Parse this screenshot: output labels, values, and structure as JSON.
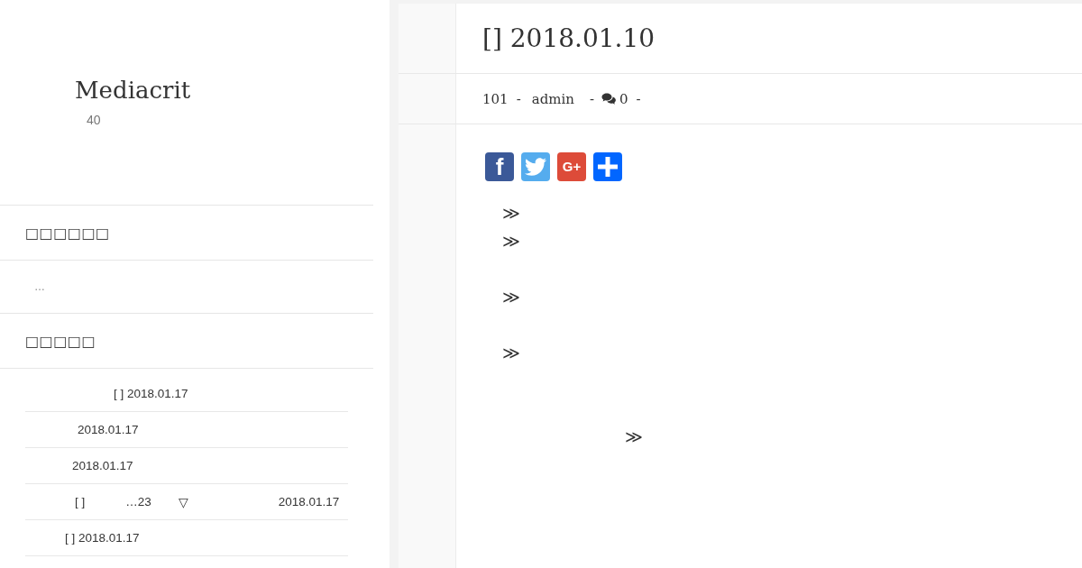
{
  "sidebar": {
    "site_title": "Mediacrit",
    "site_subtitle": "40",
    "widgets": [
      {
        "kind": "text",
        "heading": "□□□□□□",
        "text": "…"
      },
      {
        "kind": "posts",
        "heading": "□□□□□",
        "posts": [
          {
            "parts": [
              "[ ] 2018.01.17"
            ]
          },
          {
            "parts": [
              "2018.01.17"
            ]
          },
          {
            "parts": [
              "2018.01.17"
            ]
          },
          {
            "parts": [
              "[ ]",
              "…23",
              "▽",
              "2018.01.17"
            ]
          },
          {
            "parts": [
              "[ ] 2018.01.17"
            ]
          }
        ]
      }
    ]
  },
  "post": {
    "title": "[] 2018.01.10",
    "meta": [
      {
        "kind": "text",
        "text": "101"
      },
      {
        "kind": "text",
        "text": "-"
      },
      {
        "kind": "text",
        "text": "admin"
      },
      {
        "kind": "text",
        "text": "-"
      },
      {
        "kind": "comments",
        "text": "0"
      },
      {
        "kind": "text",
        "text": "-"
      }
    ],
    "share_buttons": [
      {
        "kind": "letter",
        "label": "f",
        "color": "#3b5998"
      },
      {
        "kind": "bird",
        "color": "#55acee"
      },
      {
        "kind": "letter",
        "label": "G+",
        "color": "#dd4b39"
      },
      {
        "kind": "plus",
        "color": "#0166ff"
      }
    ],
    "paragraphs": [
      "≫",
      "≫",
      "≫",
      "≫",
      "≫"
    ]
  }
}
